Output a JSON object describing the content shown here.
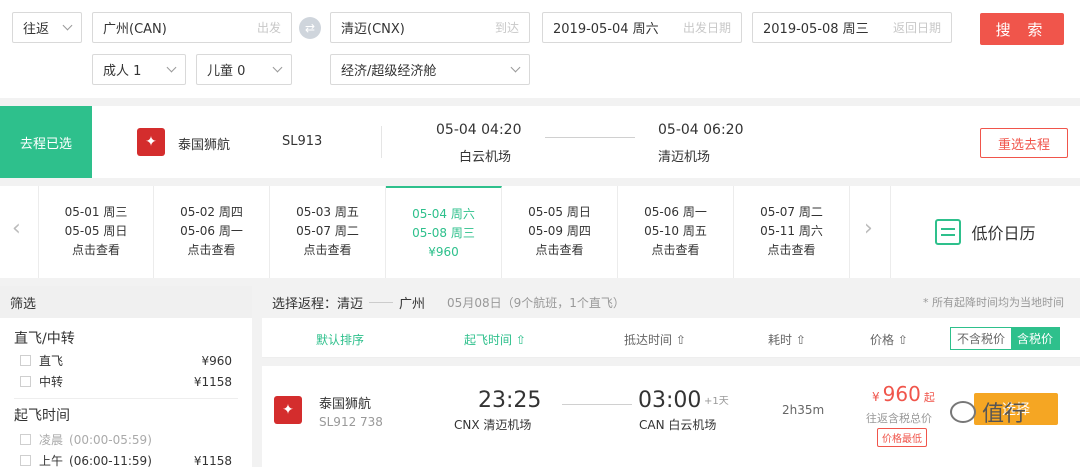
{
  "search": {
    "trip_type": "往返",
    "from_value": "广州(CAN)",
    "from_hint": "出发",
    "to_value": "清迈(CNX)",
    "to_hint": "到达",
    "depart_date": "2019-05-04 周六",
    "depart_hint": "出发日期",
    "return_date": "2019-05-08 周三",
    "return_hint": "返回日期",
    "search_label": "搜 索",
    "adults": "成人 1",
    "children": "儿童 0",
    "cabin": "经济/超级经济舱"
  },
  "selected": {
    "tag": "去程已选",
    "airline": "泰国狮航",
    "flight_no": "SL913",
    "dep_time": "05-04 04:20",
    "dep_airport": "白云机场",
    "arr_time": "05-04 06:20",
    "arr_airport": "清迈机场",
    "reselect_label": "重选去程"
  },
  "dates": [
    {
      "out": "05-01 周三",
      "ret": "05-05 周日",
      "price": "点击查看"
    },
    {
      "out": "05-02 周四",
      "ret": "05-06 周一",
      "price": "点击查看"
    },
    {
      "out": "05-03 周五",
      "ret": "05-07 周二",
      "price": "点击查看"
    },
    {
      "out": "05-04 周六",
      "ret": "05-08 周三",
      "price": "¥960"
    },
    {
      "out": "05-05 周日",
      "ret": "05-09 周四",
      "price": "点击查看"
    },
    {
      "out": "05-06 周一",
      "ret": "05-10 周五",
      "price": "点击查看"
    },
    {
      "out": "05-07 周二",
      "ret": "05-11 周六",
      "price": "点击查看"
    }
  ],
  "calendar_label": "低价日历",
  "filter": {
    "title": "筛选",
    "group1_title": "直飞/中转",
    "group1": [
      {
        "label": "直飞",
        "price": "¥960"
      },
      {
        "label": "中转",
        "price": "¥1158"
      }
    ],
    "group2_title": "起飞时间",
    "group2": [
      {
        "label": "凌晨",
        "range": "(00:00-05:59)",
        "price": ""
      },
      {
        "label": "上午",
        "range": "(06:00-11:59)",
        "price": "¥1158"
      }
    ]
  },
  "return_header": {
    "label": "选择返程：",
    "from": "清迈",
    "to": "广州",
    "date_info": "05月08日（9个航班，1个直飞）",
    "note": "* 所有起降时间均为当地时间"
  },
  "sort": {
    "default": "默认排序",
    "dep_time": "起飞时间 ⇧",
    "arr_time": "抵达时间 ⇧",
    "duration": "耗时 ⇧",
    "price": "价格 ⇧",
    "tax_off": "不含税价",
    "tax_on": "含税价"
  },
  "flight": {
    "airline": "泰国狮航",
    "code": "SL912 738",
    "dep_time": "23:25",
    "dep_airport": "CNX 清迈机场",
    "arr_time": "03:00",
    "arr_plus": "+1天",
    "arr_airport": "CAN 白云机场",
    "duration": "2h35m",
    "price_symbol": "¥",
    "price": "960",
    "price_suffix": "起",
    "price_note": "往返含税总价",
    "badge": "价格最低",
    "book_label": "选择"
  },
  "watermark": "值行",
  "colors": {
    "accent": "#2ec08c",
    "danger": "#f0554b",
    "book": "#f5a623"
  }
}
